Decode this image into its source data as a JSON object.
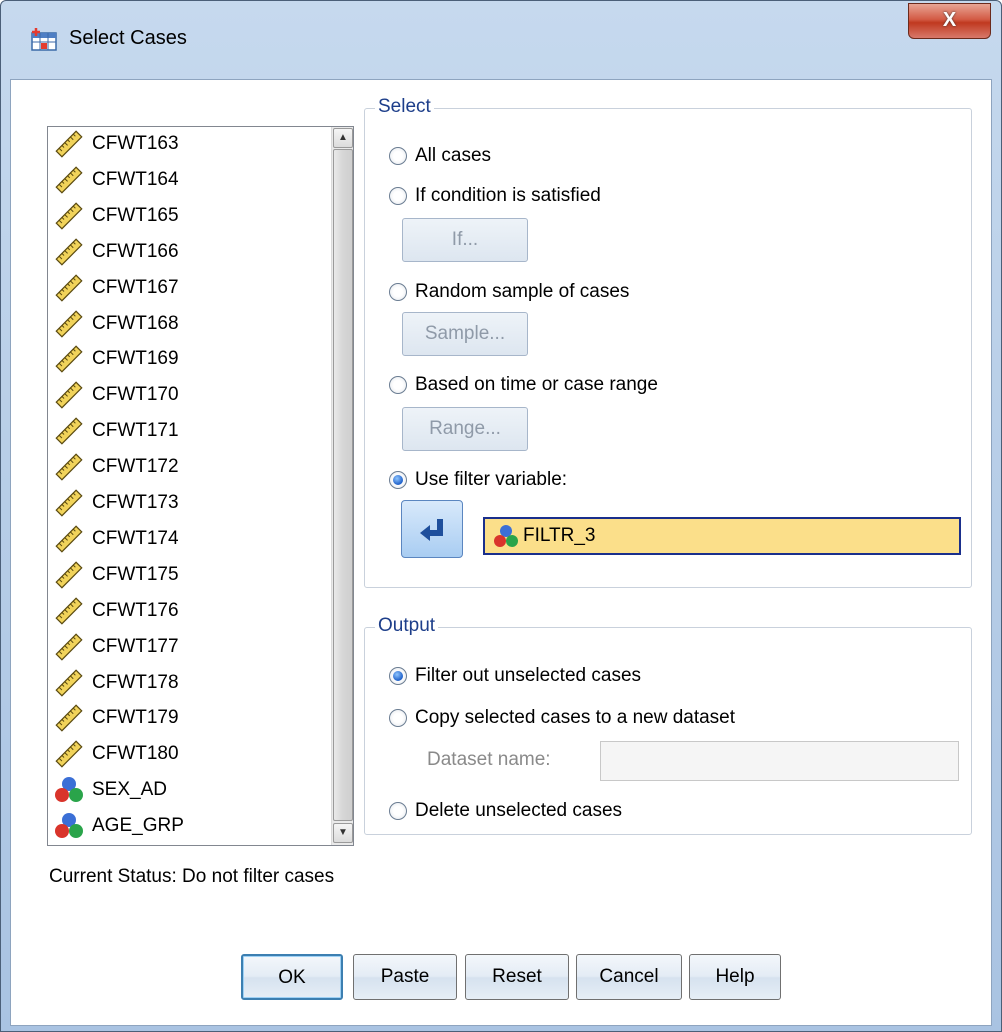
{
  "window": {
    "title": "Select Cases",
    "close_label": "X"
  },
  "variables": [
    {
      "name": "CFWT163",
      "icon": "ruler-icon"
    },
    {
      "name": "CFWT164",
      "icon": "ruler-icon"
    },
    {
      "name": "CFWT165",
      "icon": "ruler-icon"
    },
    {
      "name": "CFWT166",
      "icon": "ruler-icon"
    },
    {
      "name": "CFWT167",
      "icon": "ruler-icon"
    },
    {
      "name": "CFWT168",
      "icon": "ruler-icon"
    },
    {
      "name": "CFWT169",
      "icon": "ruler-icon"
    },
    {
      "name": "CFWT170",
      "icon": "ruler-icon"
    },
    {
      "name": "CFWT171",
      "icon": "ruler-icon"
    },
    {
      "name": "CFWT172",
      "icon": "ruler-icon"
    },
    {
      "name": "CFWT173",
      "icon": "ruler-icon"
    },
    {
      "name": "CFWT174",
      "icon": "ruler-icon"
    },
    {
      "name": "CFWT175",
      "icon": "ruler-icon"
    },
    {
      "name": "CFWT176",
      "icon": "ruler-icon"
    },
    {
      "name": "CFWT177",
      "icon": "ruler-icon"
    },
    {
      "name": "CFWT178",
      "icon": "ruler-icon"
    },
    {
      "name": "CFWT179",
      "icon": "ruler-icon"
    },
    {
      "name": "CFWT180",
      "icon": "ruler-icon"
    },
    {
      "name": "SEX_AD",
      "icon": "nominal-balls-icon"
    },
    {
      "name": "AGE_GRP",
      "icon": "nominal-balls-icon"
    }
  ],
  "status": "Current Status: Do not filter cases",
  "select": {
    "title": "Select",
    "all_cases": "All cases",
    "if_condition": "If condition is satisfied",
    "if_button": "If...",
    "random_sample": "Random sample of cases",
    "sample_button": "Sample...",
    "time_range": "Based on time or case range",
    "range_button": "Range...",
    "use_filter": "Use filter variable:",
    "filter_value": "FILTR_3",
    "selected": "use_filter"
  },
  "output": {
    "title": "Output",
    "filter_out": "Filter out unselected cases",
    "copy_selected": "Copy selected cases to a new dataset",
    "dataset_name_label": "Dataset name:",
    "dataset_name_value": "",
    "delete_unselected": "Delete unselected cases",
    "selected": "filter_out"
  },
  "buttons": {
    "ok": "OK",
    "paste": "Paste",
    "reset": "Reset",
    "cancel": "Cancel",
    "help": "Help"
  }
}
